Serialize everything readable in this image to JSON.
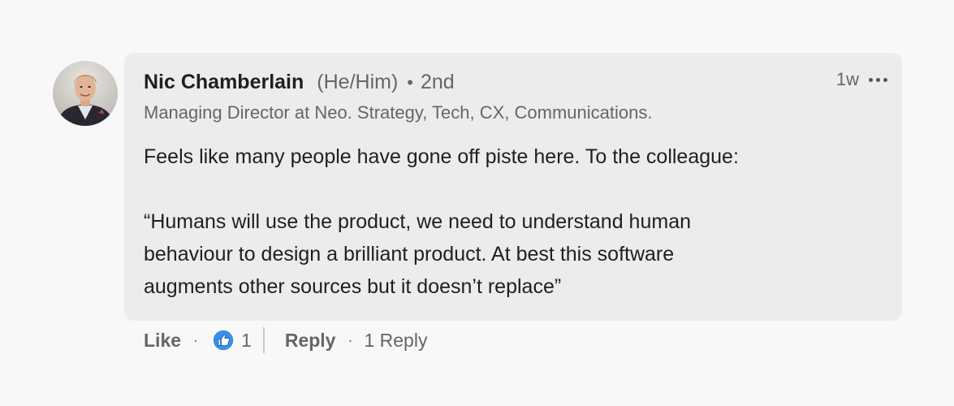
{
  "comment": {
    "author": {
      "name": "Nic Chamberlain",
      "pronouns": "(He/Him)",
      "separator": "•",
      "degree": "2nd",
      "headline": "Managing Director at Neo. Strategy, Tech, CX, Communications.",
      "avatar_icon": "profile-photo"
    },
    "timestamp": "1w",
    "more_icon": "ellipsis-icon",
    "body": {
      "line1": "Feels like many people have gone off piste here. To the colleague:",
      "line2": "“Humans will use the product, we need to understand human",
      "line3": "behaviour to design a brilliant product. At best this software",
      "line4": "augments other sources but it doesn’t replace”"
    },
    "actions": {
      "like_label": "Like",
      "dot": "·",
      "reaction_icon": "like-reaction-icon",
      "reaction_count": "1",
      "reply_label": "Reply",
      "reply_count_label": "1 Reply"
    },
    "colors": {
      "background": "#f8f8f8",
      "bubble": "#ececec",
      "like_blue": "#378fe9"
    }
  }
}
